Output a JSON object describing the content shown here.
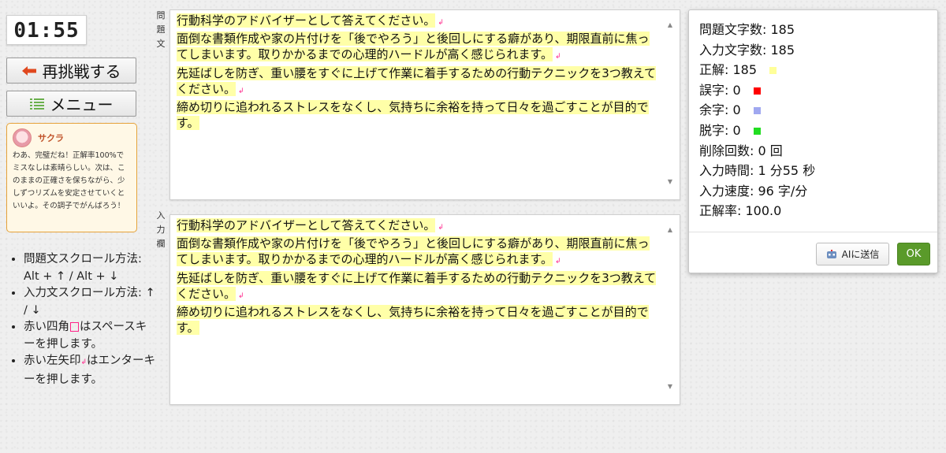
{
  "timer": "01:55",
  "buttons": {
    "retry": "再挑戦する",
    "menu": "メニュー"
  },
  "advisor": {
    "name": "サクラ",
    "message": "わあ、完璧だね！正解率100%でミスなしは素晴らしい。次は、このままの正確さを保ちながら、少しずつリズムを安定させていくといいよ。その調子でがんばろう！"
  },
  "tips": [
    {
      "text": "問題文スクロール方法: Alt + ↑ / Alt + ↓"
    },
    {
      "text": "入力文スクロール方法: ↑ / ↓"
    },
    {
      "before": "赤い四角",
      "after": "はスペースキーを押します。"
    },
    {
      "before": "赤い左矢印",
      "after": "はエンターキーを押します。"
    }
  ],
  "labels": {
    "problem": [
      "問",
      "題",
      "文"
    ],
    "input": [
      "入",
      "力",
      "欄"
    ]
  },
  "problem_lines": [
    "行動科学のアドバイザーとして答えてください。",
    "面倒な書類作成や家の片付けを「後でやろう」と後回しにする癖があり、期限直前に焦ってしまいます。取りかかるまでの心理的ハードルが高く感じられます。",
    "先延ばしを防ぎ、重い腰をすぐに上げて作業に着手するための行動テクニックを3つ教えてください。",
    "締め切りに追われるストレスをなくし、気持ちに余裕を持って日々を過ごすことが目的です。"
  ],
  "input_lines": [
    "行動科学のアドバイザーとして答えてください。",
    "面倒な書類作成や家の片付けを「後でやろう」と後回しにする癖があり、期限直前に焦ってしまいます。取りかかるまでの心理的ハードルが高く感じられます。",
    "先延ばしを防ぎ、重い腰をすぐに上げて作業に着手するための行動テクニックを3つ教えてください。",
    "締め切りに追われるストレスをなくし、気持ちに余裕を持って日々を過ごすことが目的です。"
  ],
  "stats": [
    {
      "text": "問題文字数: 185"
    },
    {
      "text": "入力文字数: 185"
    },
    {
      "text": "正解: 185",
      "color": "#ffff99"
    },
    {
      "text": "誤字: 0",
      "color": "#ff0000"
    },
    {
      "text": "余字: 0",
      "color": "#a0a8f0"
    },
    {
      "text": "脱字: 0",
      "color": "#22dd22"
    },
    {
      "text": "削除回数: 0 回"
    },
    {
      "text": "入力時間: 1 分55 秒"
    },
    {
      "text": "入力速度: 96 字/分"
    },
    {
      "text": "正解率: 100.0"
    }
  ],
  "result_buttons": {
    "ai": "AIに送信",
    "ok": "OK"
  },
  "colors": {
    "accent_orange": "#e5a23a",
    "ok_green": "#5a9a2a",
    "highlight": "#ffffa8",
    "marker_red": "#ff2288"
  }
}
